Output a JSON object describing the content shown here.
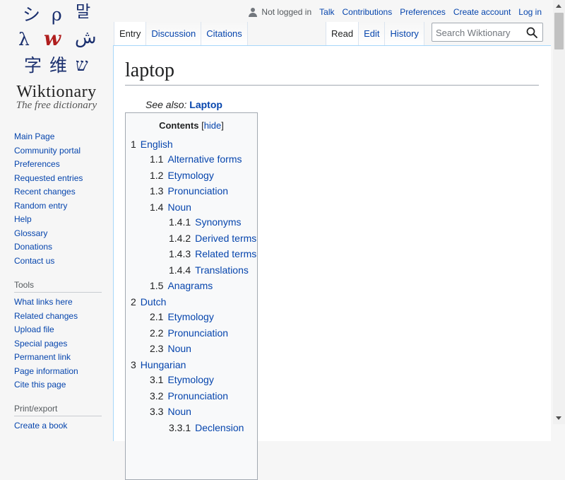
{
  "logo": {
    "glyphs": [
      "シ",
      "ρ",
      "말",
      "λ",
      "w",
      "ش",
      "字",
      "维",
      "ש"
    ],
    "wordmark": "Wiktionary",
    "tagline": "The free dictionary"
  },
  "personal": {
    "not_logged_in": "Not logged in",
    "talk": "Talk",
    "contributions": "Contributions",
    "preferences": "Preferences",
    "create_account": "Create account",
    "log_in": "Log in"
  },
  "tabs": {
    "left": [
      "Entry",
      "Discussion",
      "Citations"
    ],
    "right": [
      "Read",
      "Edit",
      "History"
    ]
  },
  "search": {
    "placeholder": "Search Wiktionary"
  },
  "sidebar": {
    "main": [
      "Main Page",
      "Community portal",
      "Preferences",
      "Requested entries",
      "Recent changes",
      "Random entry",
      "Help",
      "Glossary",
      "Donations",
      "Contact us"
    ],
    "tools_heading": "Tools",
    "tools": [
      "What links here",
      "Related changes",
      "Upload file",
      "Special pages",
      "Permanent link",
      "Page information",
      "Cite this page"
    ],
    "print_heading": "Print/export",
    "print": [
      "Create a book"
    ]
  },
  "page": {
    "title": "laptop",
    "see_also_label": "See also:",
    "see_also_link": "Laptop"
  },
  "toc": {
    "title": "Contents",
    "hide_label": "hide",
    "items": [
      {
        "num": "1",
        "text": "English"
      },
      {
        "num": "1.1",
        "text": "Alternative forms"
      },
      {
        "num": "1.2",
        "text": "Etymology"
      },
      {
        "num": "1.3",
        "text": "Pronunciation"
      },
      {
        "num": "1.4",
        "text": "Noun"
      },
      {
        "num": "1.4.1",
        "text": "Synonyms"
      },
      {
        "num": "1.4.2",
        "text": "Derived terms"
      },
      {
        "num": "1.4.3",
        "text": "Related terms"
      },
      {
        "num": "1.4.4",
        "text": "Translations"
      },
      {
        "num": "1.5",
        "text": "Anagrams"
      },
      {
        "num": "2",
        "text": "Dutch"
      },
      {
        "num": "2.1",
        "text": "Etymology"
      },
      {
        "num": "2.2",
        "text": "Pronunciation"
      },
      {
        "num": "2.3",
        "text": "Noun"
      },
      {
        "num": "3",
        "text": "Hungarian"
      },
      {
        "num": "3.1",
        "text": "Etymology"
      },
      {
        "num": "3.2",
        "text": "Pronunciation"
      },
      {
        "num": "3.3",
        "text": "Noun"
      },
      {
        "num": "3.3.1",
        "text": "Declension"
      }
    ]
  }
}
